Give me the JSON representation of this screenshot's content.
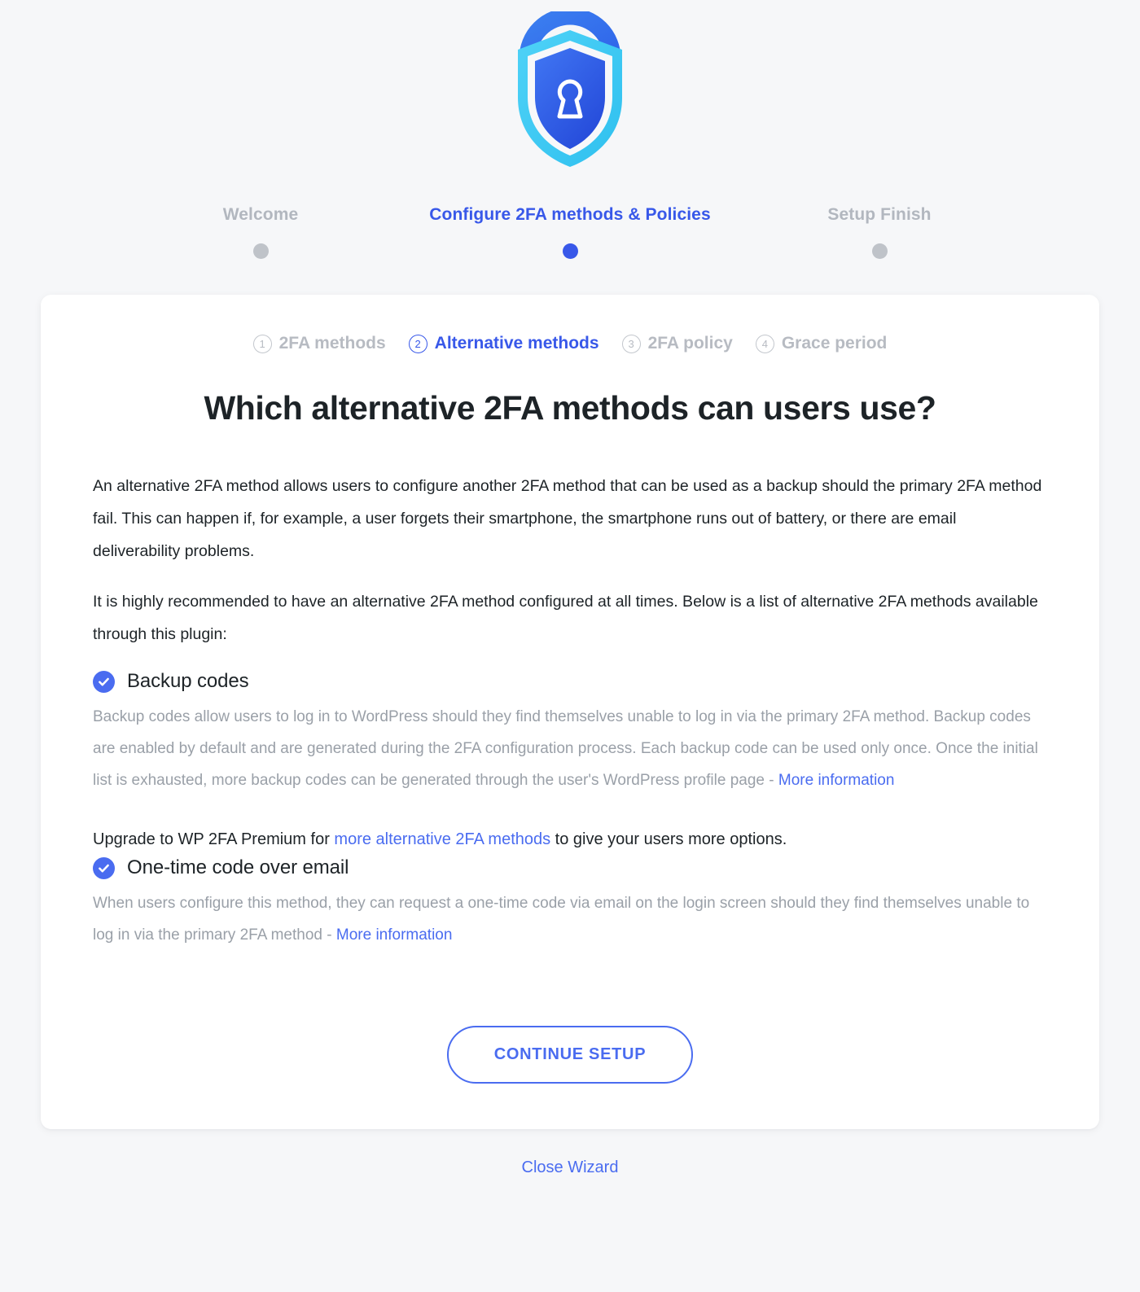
{
  "logo": {
    "name": "wp-2fa-shield-lock-logo",
    "colors": {
      "outer": "#35c6f4",
      "inner": "#2563eb",
      "mid": "#3b82f6"
    }
  },
  "top_steps": [
    {
      "label": "Welcome",
      "active": false
    },
    {
      "label": "Configure 2FA methods & Policies",
      "active": true
    },
    {
      "label": "Setup Finish",
      "active": false
    }
  ],
  "tabs": [
    {
      "num": "1",
      "label": "2FA methods",
      "active": false
    },
    {
      "num": "2",
      "label": "Alternative methods",
      "active": true
    },
    {
      "num": "3",
      "label": "2FA policy",
      "active": false
    },
    {
      "num": "4",
      "label": "Grace period",
      "active": false
    }
  ],
  "headline": "Which alternative 2FA methods can users use?",
  "paragraphs": {
    "intro": "An alternative 2FA method allows users to configure another 2FA method that can be used as a backup should the primary 2FA method fail. This can happen if, for example, a user forgets their smartphone, the smartphone runs out of battery, or there are email deliverability problems.",
    "recommend": "It is highly recommended to have an alternative 2FA method configured at all times. Below is a list of alternative 2FA methods available through this plugin:"
  },
  "methods": [
    {
      "label": "Backup codes",
      "checked": true,
      "description": "Backup codes allow users to log in to WordPress should they find themselves unable to log in via the primary 2FA method. Backup codes are enabled by default and are generated during the 2FA configuration process. Each backup code can be used only once. Once the initial list is exhausted, more backup codes can be generated through the user's WordPress profile page - ",
      "link_text": "More information"
    },
    {
      "label": "One-time code over email",
      "checked": true,
      "description": "When users configure this method, they can request a one-time code via email on the login screen should they find themselves unable to log in via the primary 2FA method - ",
      "link_text": "More information"
    }
  ],
  "upgrade": {
    "prefix": "Upgrade to WP 2FA Premium for ",
    "link_text": "more alternative 2FA methods",
    "suffix": " to give your users more options."
  },
  "continue_button": "CONTINUE SETUP",
  "close_wizard": "Close Wizard",
  "colors": {
    "accent": "#4a6cf0",
    "accent_step": "#3858e9",
    "muted": "#9aa0a8",
    "text": "#1d2327",
    "page_bg": "#f6f7f9",
    "card_bg": "#ffffff"
  }
}
